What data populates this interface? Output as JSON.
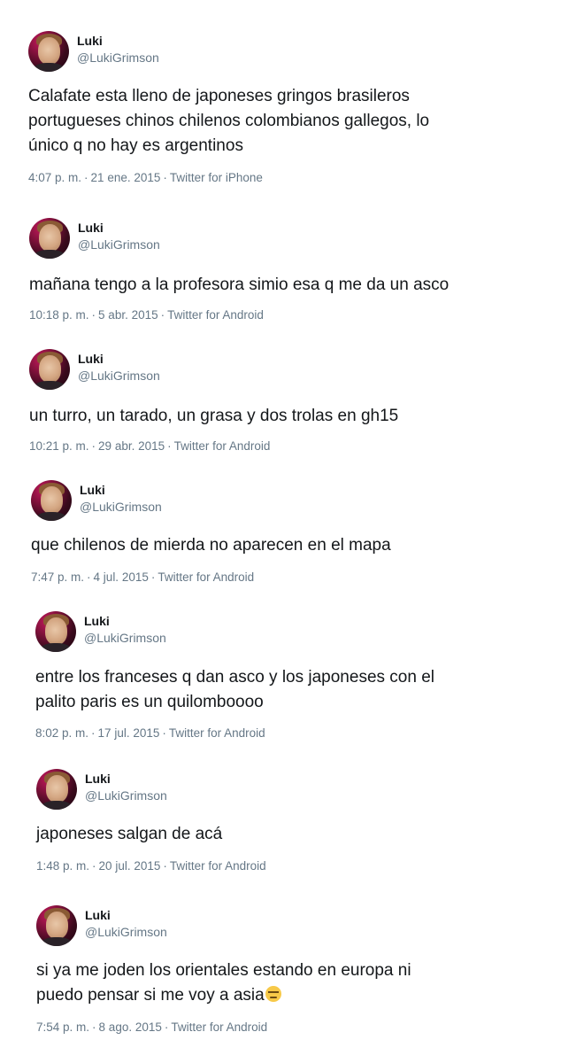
{
  "tweets": [
    {
      "name": "Luki",
      "handle": "@LukiGrimson",
      "text": "Calafate esta lleno de japoneses gringos brasileros\nportugueses chinos chilenos colombianos gallegos, lo\núnico q no hay es argentinos",
      "time": "4:07 p. m.",
      "date": "21 ene. 2015",
      "client": "Twitter for iPhone"
    },
    {
      "name": "Luki",
      "handle": "@LukiGrimson",
      "text": "mañana tengo a la profesora simio esa q me da un asco",
      "time": "10:18 p. m.",
      "date": "5 abr. 2015",
      "client": "Twitter for Android"
    },
    {
      "name": "Luki",
      "handle": "@LukiGrimson",
      "text": "un turro, un tarado, un grasa y dos trolas en gh15",
      "time": "10:21 p. m.",
      "date": "29 abr. 2015",
      "client": "Twitter for Android"
    },
    {
      "name": "Luki",
      "handle": "@LukiGrimson",
      "text": "que chilenos de mierda no aparecen en el mapa",
      "time": "7:47 p. m.",
      "date": "4 jul. 2015",
      "client": "Twitter for Android"
    },
    {
      "name": "Luki",
      "handle": "@LukiGrimson",
      "text": "entre los franceses q dan asco y los japoneses con el\npalito paris es un quilomboooo",
      "time": "8:02 p. m.",
      "date": "17 jul. 2015",
      "client": "Twitter for Android"
    },
    {
      "name": "Luki",
      "handle": "@LukiGrimson",
      "text": "japoneses salgan de acá",
      "time": "1:48 p. m.",
      "date": "20 jul. 2015",
      "client": "Twitter for Android"
    },
    {
      "name": "Luki",
      "handle": "@LukiGrimson",
      "text": "si ya me joden los orientales estando en europa ni\npuedo pensar si me voy a asia",
      "emoji": "unamused-face-emoji",
      "time": "7:54 p. m.",
      "date": "8 ago. 2015",
      "client": "Twitter for Android"
    }
  ],
  "separator": "·"
}
